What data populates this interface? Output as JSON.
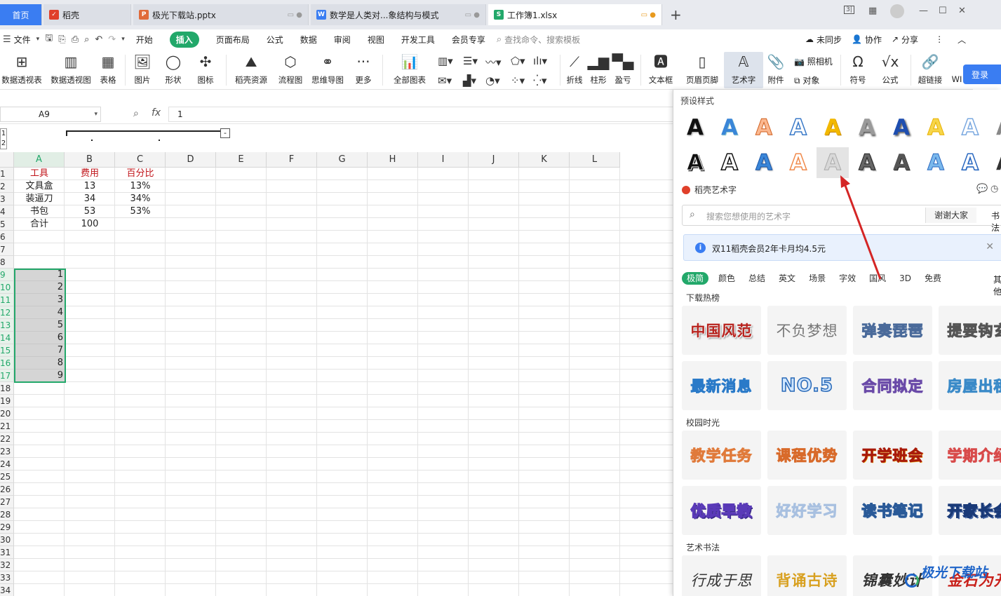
{
  "tabs": [
    {
      "label": "首页",
      "kind": "home"
    },
    {
      "label": "稻壳",
      "icon": "docer-icon"
    },
    {
      "label": "极光下载站.pptx",
      "icon": "ppt-icon"
    },
    {
      "label": "数学是人类对...象结构与模式",
      "icon": "word-icon"
    },
    {
      "label": "工作簿1.xlsx",
      "icon": "excel-icon",
      "active": true
    }
  ],
  "new_tab": "+",
  "menu": {
    "file": "文件",
    "items": [
      "开始",
      "插入",
      "页面布局",
      "公式",
      "数据",
      "审阅",
      "视图",
      "开发工具",
      "会员专享"
    ],
    "active": "插入",
    "search_placeholder": "查找命令、搜索模板",
    "unsynced": "未同步",
    "collab": "协作",
    "share": "分享"
  },
  "ribbon": {
    "pivot_table": "数据透视表",
    "pivot_chart": "数据透视图",
    "table": "表格",
    "picture": "图片",
    "shape": "形状",
    "icons": "图标",
    "docer_res": "稻壳资源",
    "flowchart": "流程图",
    "mindmap": "思维导图",
    "more": "更多",
    "all_charts": "全部图表",
    "line": "折线",
    "column": "柱形",
    "winloss": "盈亏",
    "textbox": "文本框",
    "header_footer": "页眉页脚",
    "wordart": "艺术字",
    "attach": "附件",
    "camera": "照相机",
    "object": "对象",
    "symbol": "符号",
    "formula": "公式",
    "hyperlink": "超链接",
    "wi": "WI",
    "login": "登录"
  },
  "formula_bar": {
    "cell_ref": "A9",
    "fx": "fx",
    "value": "1"
  },
  "sheet": {
    "columns": [
      "A",
      "B",
      "C",
      "D",
      "E",
      "F",
      "G",
      "H",
      "I",
      "J",
      "K",
      "L"
    ],
    "rows": [
      "1",
      "2",
      "3",
      "4",
      "5",
      "6",
      "7",
      "8",
      "9",
      "10",
      "11",
      "12",
      "13",
      "14",
      "15",
      "16",
      "17",
      "18",
      "19",
      "20",
      "21",
      "22",
      "23",
      "24",
      "25",
      "26",
      "27",
      "28",
      "29",
      "30",
      "31",
      "32",
      "33",
      "34"
    ],
    "header": [
      "工具",
      "费用",
      "百分比"
    ],
    "data": [
      [
        "文具盒",
        "13",
        "13%"
      ],
      [
        "装逼刀",
        "34",
        "34%"
      ],
      [
        "书包",
        "53",
        "53%"
      ],
      [
        "合计",
        "100",
        ""
      ]
    ],
    "sequence": [
      "1",
      "2",
      "3",
      "4",
      "5",
      "6",
      "7",
      "8",
      "9"
    ],
    "outline_levels": [
      "1",
      "2"
    ],
    "outline_btn": "-"
  },
  "panel": {
    "preset_title": "预设样式",
    "preset_letter": "A",
    "docer_title": "稻壳艺术字",
    "search_placeholder": "搜索您想使用的艺术字",
    "thanks": "谢谢大家",
    "calligraphy": "书法",
    "notice": "双11稻壳会员2年卡月均4.5元",
    "categories": [
      "极简",
      "颜色",
      "总结",
      "英文",
      "场景",
      "字效",
      "国风",
      "3D",
      "免费"
    ],
    "categories_more": "其他",
    "section1": "下载热榜",
    "section2": "校园时光",
    "section3": "艺术书法",
    "cards1": [
      "中国风范",
      "不负梦想",
      "弹奏琵琶",
      "提要钩玄"
    ],
    "cards2": [
      "最新消息",
      "NO.5",
      "合同拟定",
      "房屋出租"
    ],
    "cards3": [
      "教学任务",
      "课程优势",
      "开学班会",
      "学期介绍"
    ],
    "cards4": [
      "优质早教",
      "好好学习",
      "读书笔记",
      "开家长会"
    ],
    "cards5": [
      "行成于思",
      "背诵古诗",
      "锦囊妙计",
      "金石为开"
    ]
  },
  "watermark": "极光下载站",
  "colors": {
    "accent": "#22a86a",
    "brand": "#3a7df2",
    "header_red": "#c0141a",
    "arrow": "#d42525"
  }
}
